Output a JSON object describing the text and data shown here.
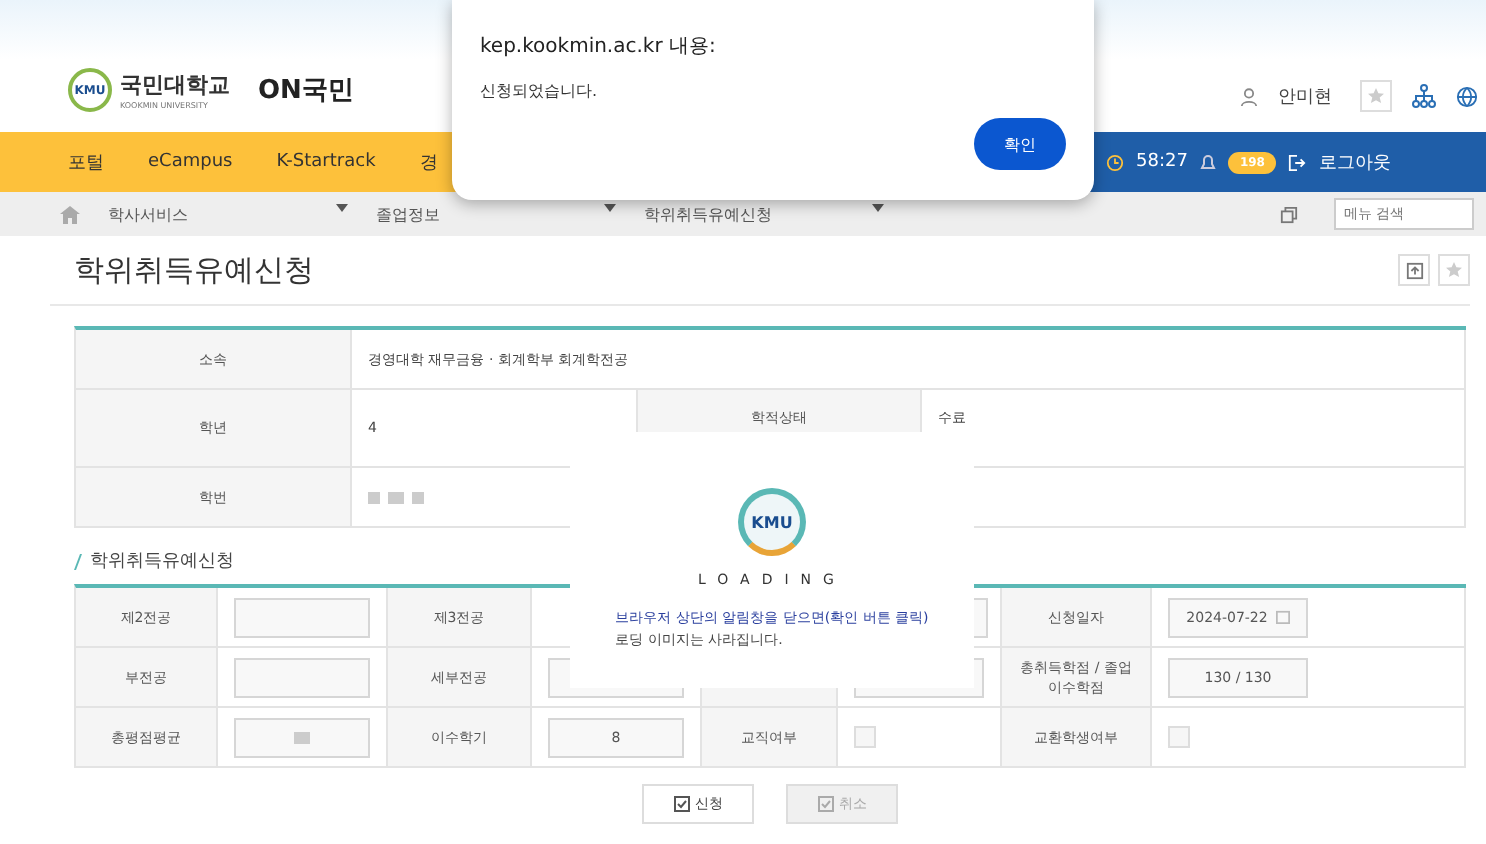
{
  "header": {
    "logo_badge": "KMU",
    "logo_name": "국민대학교",
    "logo_sub": "KOOKMIN UNIVERSITY",
    "service_name_latin": "ON",
    "service_name": "국민",
    "user": "안미현"
  },
  "top_menu": [
    {
      "label": "포털"
    },
    {
      "label": "eCampus"
    },
    {
      "label": "K-Startrack"
    },
    {
      "label": "경"
    }
  ],
  "session": {
    "timer": "58:27",
    "badge": "198",
    "logout": "로그아웃"
  },
  "breadcrumb": [
    "학사서비스",
    "졸업정보",
    "학위취득유예신청"
  ],
  "menu_search": {
    "placeholder": "메뉴 검색"
  },
  "page_title": "학위취득유예신청",
  "info": {
    "affiliation_label": "소속",
    "affiliation": "경영대학 재무금융 · 회계학부 회계학전공",
    "grade_label": "학년",
    "grade": "4",
    "status_label": "학적상태",
    "status": "수료",
    "student_id_label": "학번"
  },
  "section_title": "학위취득유예신청",
  "form": {
    "second_major_label": "제2전공",
    "third_major_label": "제3전공",
    "date_label": "신청일자",
    "date": "2024-07-22",
    "minor_label": "부전공",
    "sub_major_label": "세부전공",
    "credits_label": "총취득학점 / 졸업이수학점",
    "credits": "130 / 130",
    "gpa_label": "총평점평균",
    "semesters_label": "이수학기",
    "semesters": "8",
    "teaching_label": "교직여부",
    "teaching_checked": false,
    "exchange_label": "교환학생여부",
    "exchange_checked": false
  },
  "buttons": [
    {
      "label": "신청",
      "disabled": false
    },
    {
      "label": "취소",
      "disabled": true
    }
  ],
  "loading": {
    "badge": "KMU",
    "title": "LOADING",
    "message_bold": "브라우저 상단의 알림창을 닫으면(확인 버튼 클릭)",
    "message": "로딩 이미지는 사라집니다."
  },
  "alert": {
    "title": "kep.kookmin.ac.kr 내용:",
    "message": "신청되었습니다.",
    "button": "확인"
  }
}
